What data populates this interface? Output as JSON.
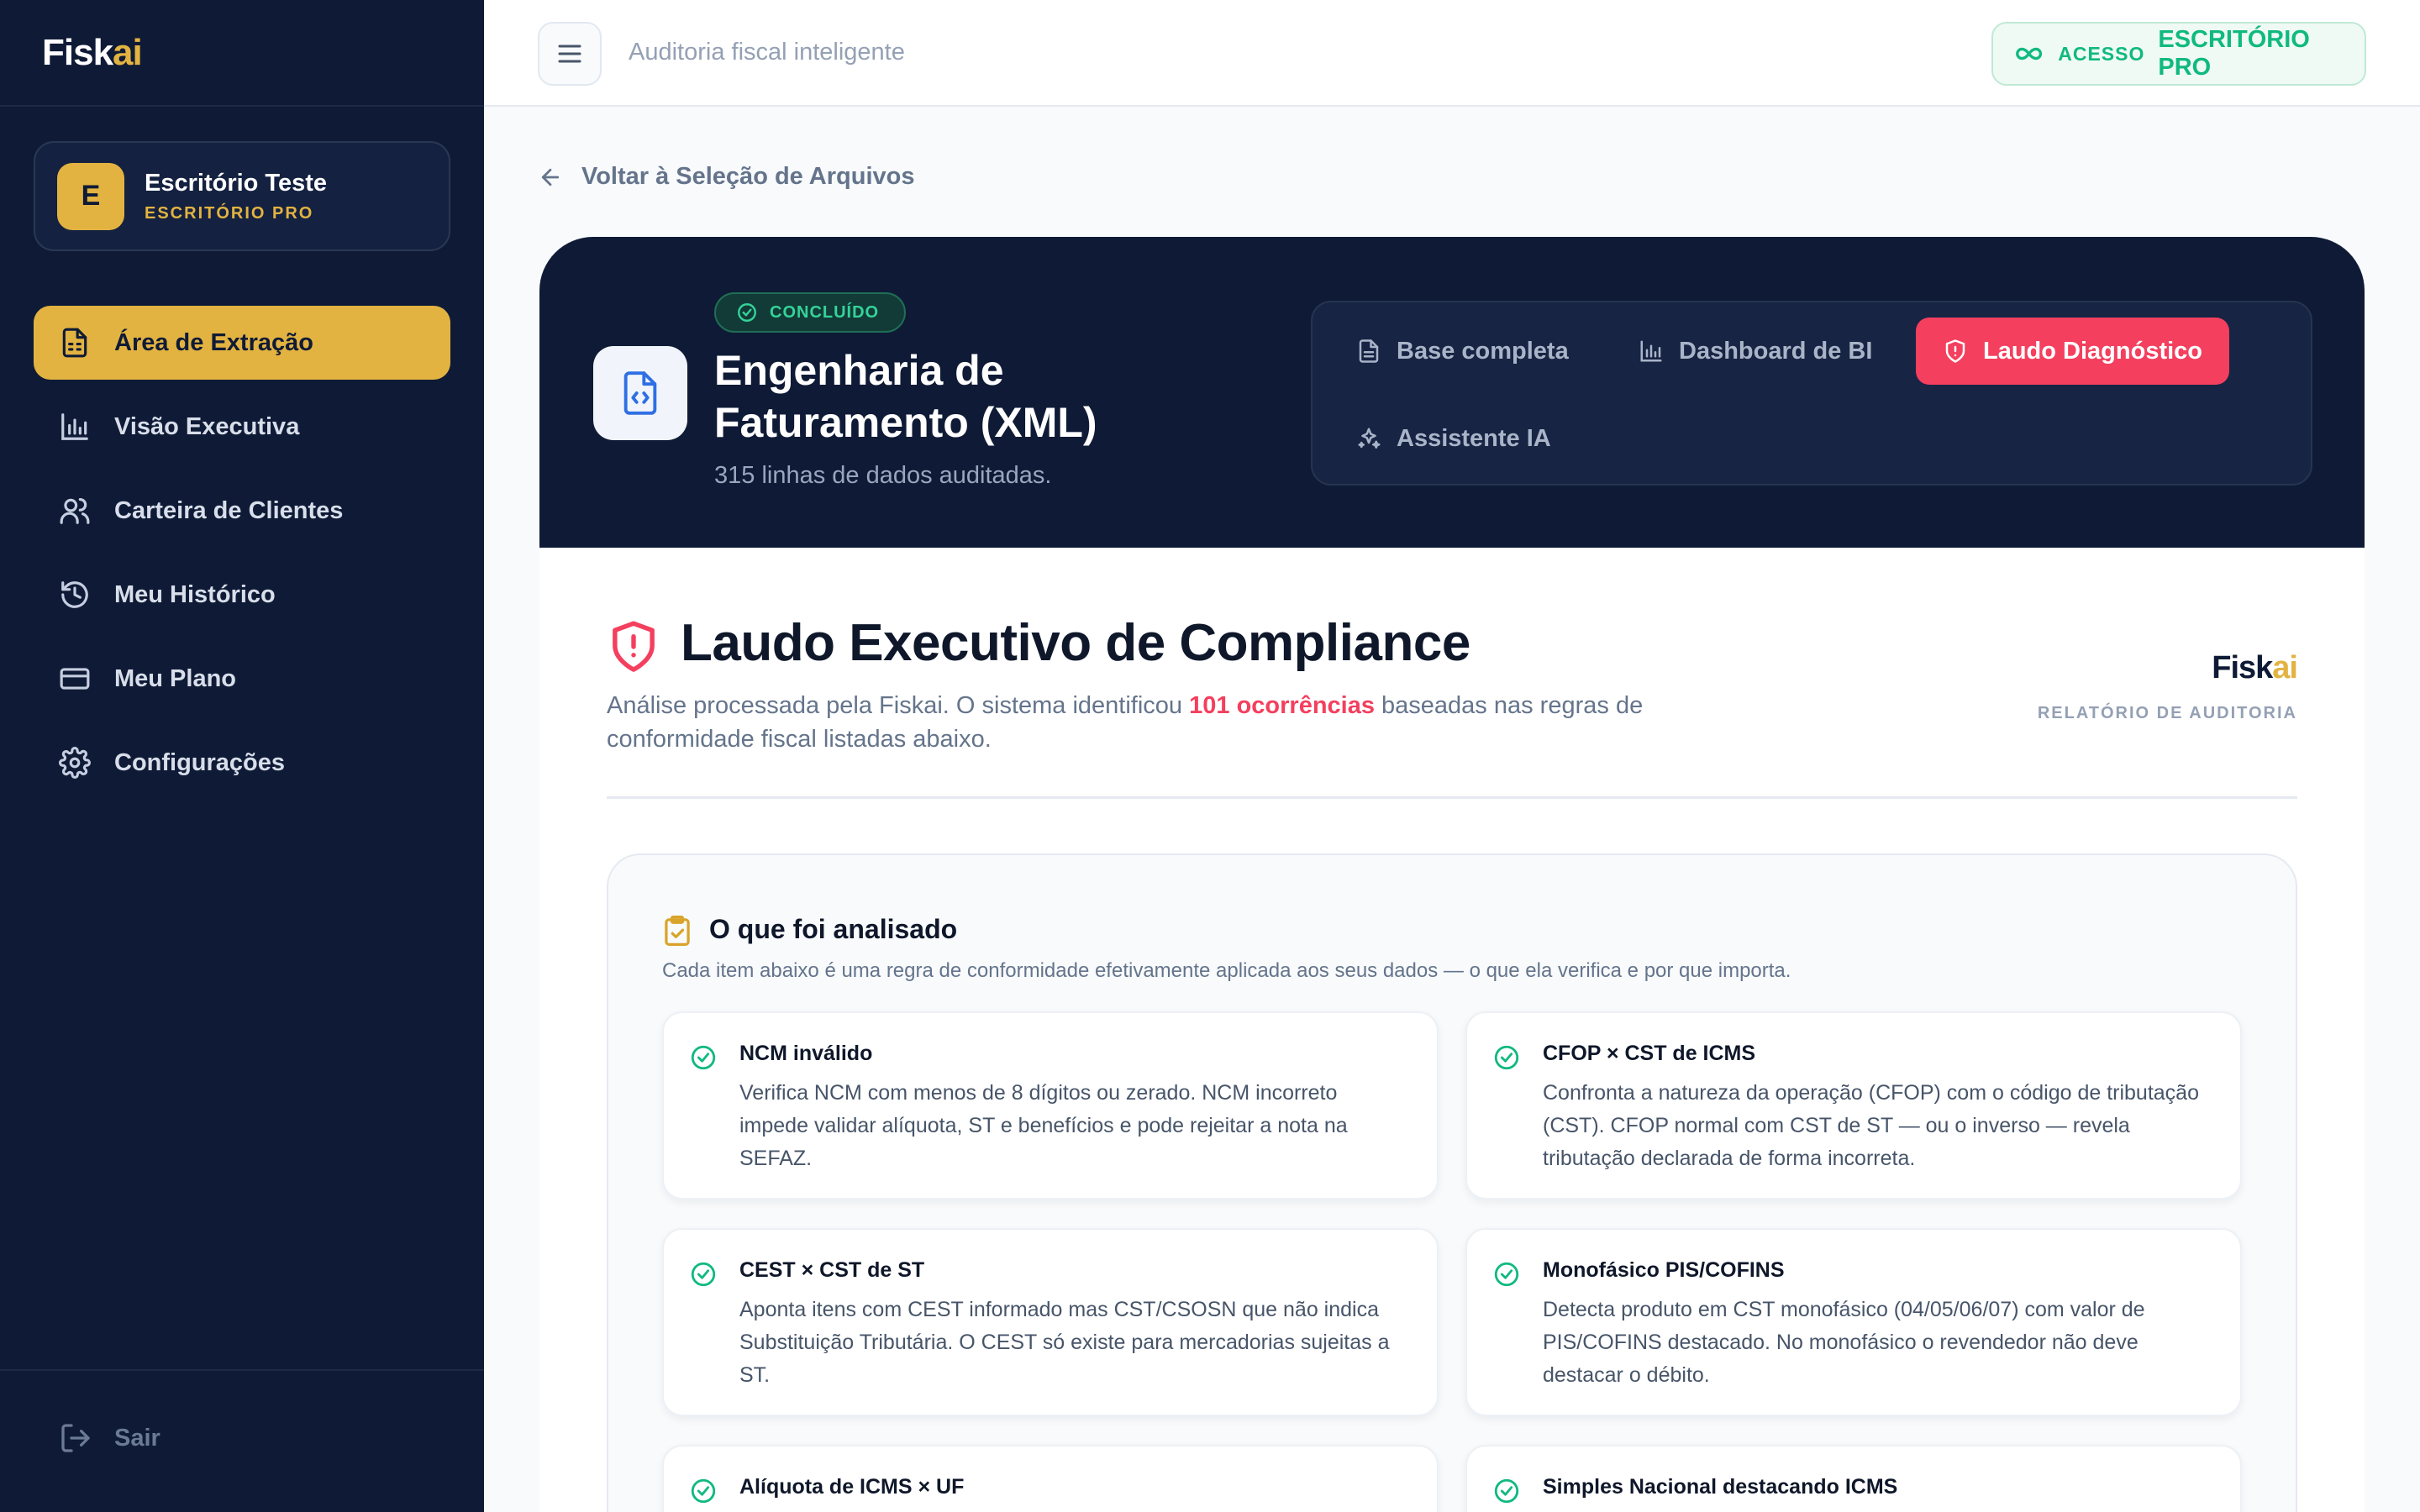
{
  "brand": {
    "name_main": "Fisk",
    "name_accent": "ai"
  },
  "account": {
    "initial": "E",
    "name": "Escritório Teste",
    "plan": "ESCRITÓRIO PRO"
  },
  "nav": [
    {
      "label": "Área de Extração",
      "icon": "document-icon",
      "active": true
    },
    {
      "label": "Visão Executiva",
      "icon": "bar-chart-icon"
    },
    {
      "label": "Carteira de Clientes",
      "icon": "users-icon"
    },
    {
      "label": "Meu Histórico",
      "icon": "history-icon"
    },
    {
      "label": "Meu Plano",
      "icon": "credit-card-icon"
    },
    {
      "label": "Configurações",
      "icon": "gear-icon"
    }
  ],
  "logout_label": "Sair",
  "topbar": {
    "title": "Auditoria fiscal inteligente",
    "access_label": "ACESSO",
    "access_plan": "ESCRITÓRIO PRO"
  },
  "back_label": "Voltar à Seleção de Arquivos",
  "hero": {
    "status": "CONCLUÍDO",
    "title": "Engenharia de Faturamento (XML)",
    "subtitle": "315 linhas de dados auditadas.",
    "tabs": [
      {
        "label": "Base completa",
        "icon": "document-icon"
      },
      {
        "label": "Dashboard de BI",
        "icon": "bar-chart-icon"
      },
      {
        "label": "Laudo Diagnóstico",
        "icon": "shield-icon",
        "active": true
      },
      {
        "label": "Assistente IA",
        "icon": "sparkles-icon"
      }
    ]
  },
  "report": {
    "title": "Laudo Executivo de Compliance",
    "desc_before": "Análise processada pela Fiskai. O sistema identificou ",
    "desc_highlight": "101 ocorrências",
    "desc_after": " baseadas nas regras de conformidade fiscal listadas abaixo.",
    "brand_main": "Fisk",
    "brand_accent": "ai",
    "brand_sub": "RELATÓRIO DE AUDITORIA"
  },
  "analysis": {
    "title": "O que foi analisado",
    "subtitle": "Cada item abaixo é uma regra de conformidade efetivamente aplicada aos seus dados — o que ela verifica e por que importa.",
    "rules": [
      {
        "title": "NCM inválido",
        "desc": "Verifica NCM com menos de 8 dígitos ou zerado. NCM incorreto impede validar alíquota, ST e benefícios e pode rejeitar a nota na SEFAZ."
      },
      {
        "title": "CFOP × CST de ICMS",
        "desc": "Confronta a natureza da operação (CFOP) com o código de tributação (CST). CFOP normal com CST de ST — ou o inverso — revela tributação declarada de forma incorreta."
      },
      {
        "title": "CEST × CST de ST",
        "desc": "Aponta itens com CEST informado mas CST/CSOSN que não indica Substituição Tributária. O CEST só existe para mercadorias sujeitas a ST."
      },
      {
        "title": "Monofásico PIS/COFINS",
        "desc": "Detecta produto em CST monofásico (04/05/06/07) com valor de PIS/COFINS destacado. No monofásico o revendedor não deve destacar o débito."
      },
      {
        "title": "Alíquota de ICMS × UF",
        "desc": ""
      },
      {
        "title": "Simples Nacional destacando ICMS",
        "desc": ""
      }
    ]
  },
  "colors": {
    "sidebar": "#0f1b36",
    "accent_gold": "#e3b341",
    "accent_red": "#f43f5e",
    "success_green": "#10b981"
  }
}
